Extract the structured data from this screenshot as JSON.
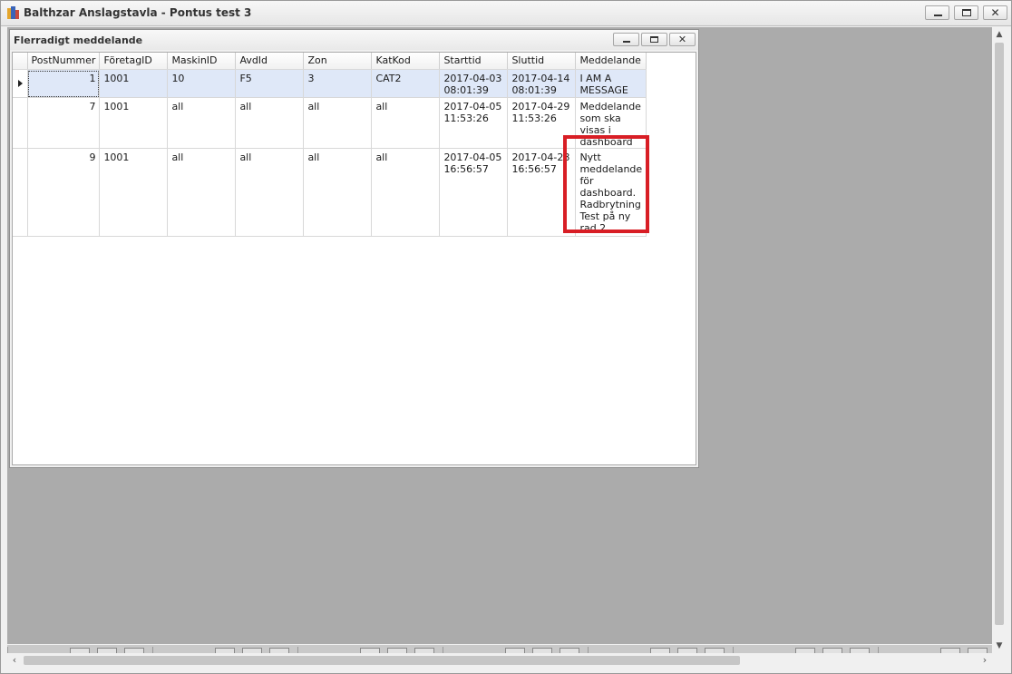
{
  "app": {
    "title": "Balthzar Anslagstavla - Pontus test 3",
    "window_buttons": {
      "minimize": "–",
      "maximize": "□",
      "close": "✕"
    }
  },
  "child_window": {
    "title": "Flerradigt meddelande",
    "window_buttons": {
      "minimize": "–",
      "maximize": "□",
      "close": "✕"
    }
  },
  "grid": {
    "columns": [
      "PostNummer",
      "FöretagID",
      "MaskinID",
      "AvdId",
      "Zon",
      "KatKod",
      "Starttid",
      "Sluttid",
      "Meddelande"
    ],
    "rows": [
      {
        "selected": true,
        "cells": [
          "1",
          "1001",
          "10",
          "F5",
          "3",
          "CAT2",
          "2017-04-03 08:01:39",
          "2017-04-14 08:01:39",
          "I AM A MESSAGE"
        ]
      },
      {
        "selected": false,
        "cells": [
          "7",
          "1001",
          "all",
          "all",
          "all",
          "all",
          "2017-04-05 11:53:26",
          "2017-04-29 11:53:26",
          "Meddelande som ska visas i dashboard"
        ]
      },
      {
        "selected": false,
        "cells": [
          "9",
          "1001",
          "all",
          "all",
          "all",
          "all",
          "2017-04-05 16:56:57",
          "2017-04-28 16:56:57",
          "Nytt meddelande för dashboard. Radbrytning Test på ny rad 2"
        ]
      }
    ]
  },
  "colors": {
    "workspace": "#ababab",
    "selected_row": "#dfe8f8",
    "highlight": "#d81e25"
  }
}
